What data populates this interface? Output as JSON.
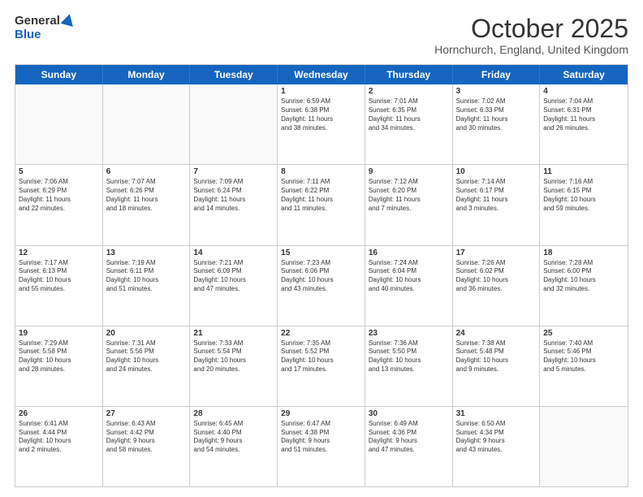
{
  "header": {
    "logo_line1": "General",
    "logo_line2": "Blue",
    "month": "October 2025",
    "location": "Hornchurch, England, United Kingdom"
  },
  "day_headers": [
    "Sunday",
    "Monday",
    "Tuesday",
    "Wednesday",
    "Thursday",
    "Friday",
    "Saturday"
  ],
  "weeks": [
    [
      {
        "date": "",
        "info": ""
      },
      {
        "date": "",
        "info": ""
      },
      {
        "date": "",
        "info": ""
      },
      {
        "date": "1",
        "info": "Sunrise: 6:59 AM\nSunset: 6:38 PM\nDaylight: 11 hours\nand 38 minutes."
      },
      {
        "date": "2",
        "info": "Sunrise: 7:01 AM\nSunset: 6:35 PM\nDaylight: 11 hours\nand 34 minutes."
      },
      {
        "date": "3",
        "info": "Sunrise: 7:02 AM\nSunset: 6:33 PM\nDaylight: 11 hours\nand 30 minutes."
      },
      {
        "date": "4",
        "info": "Sunrise: 7:04 AM\nSunset: 6:31 PM\nDaylight: 11 hours\nand 26 minutes."
      }
    ],
    [
      {
        "date": "5",
        "info": "Sunrise: 7:06 AM\nSunset: 6:29 PM\nDaylight: 11 hours\nand 22 minutes."
      },
      {
        "date": "6",
        "info": "Sunrise: 7:07 AM\nSunset: 6:26 PM\nDaylight: 11 hours\nand 18 minutes."
      },
      {
        "date": "7",
        "info": "Sunrise: 7:09 AM\nSunset: 6:24 PM\nDaylight: 11 hours\nand 14 minutes."
      },
      {
        "date": "8",
        "info": "Sunrise: 7:11 AM\nSunset: 6:22 PM\nDaylight: 11 hours\nand 11 minutes."
      },
      {
        "date": "9",
        "info": "Sunrise: 7:12 AM\nSunset: 6:20 PM\nDaylight: 11 hours\nand 7 minutes."
      },
      {
        "date": "10",
        "info": "Sunrise: 7:14 AM\nSunset: 6:17 PM\nDaylight: 11 hours\nand 3 minutes."
      },
      {
        "date": "11",
        "info": "Sunrise: 7:16 AM\nSunset: 6:15 PM\nDaylight: 10 hours\nand 59 minutes."
      }
    ],
    [
      {
        "date": "12",
        "info": "Sunrise: 7:17 AM\nSunset: 6:13 PM\nDaylight: 10 hours\nand 55 minutes."
      },
      {
        "date": "13",
        "info": "Sunrise: 7:19 AM\nSunset: 6:11 PM\nDaylight: 10 hours\nand 51 minutes."
      },
      {
        "date": "14",
        "info": "Sunrise: 7:21 AM\nSunset: 6:09 PM\nDaylight: 10 hours\nand 47 minutes."
      },
      {
        "date": "15",
        "info": "Sunrise: 7:23 AM\nSunset: 6:06 PM\nDaylight: 10 hours\nand 43 minutes."
      },
      {
        "date": "16",
        "info": "Sunrise: 7:24 AM\nSunset: 6:04 PM\nDaylight: 10 hours\nand 40 minutes."
      },
      {
        "date": "17",
        "info": "Sunrise: 7:26 AM\nSunset: 6:02 PM\nDaylight: 10 hours\nand 36 minutes."
      },
      {
        "date": "18",
        "info": "Sunrise: 7:28 AM\nSunset: 6:00 PM\nDaylight: 10 hours\nand 32 minutes."
      }
    ],
    [
      {
        "date": "19",
        "info": "Sunrise: 7:29 AM\nSunset: 5:58 PM\nDaylight: 10 hours\nand 28 minutes."
      },
      {
        "date": "20",
        "info": "Sunrise: 7:31 AM\nSunset: 5:56 PM\nDaylight: 10 hours\nand 24 minutes."
      },
      {
        "date": "21",
        "info": "Sunrise: 7:33 AM\nSunset: 5:54 PM\nDaylight: 10 hours\nand 20 minutes."
      },
      {
        "date": "22",
        "info": "Sunrise: 7:35 AM\nSunset: 5:52 PM\nDaylight: 10 hours\nand 17 minutes."
      },
      {
        "date": "23",
        "info": "Sunrise: 7:36 AM\nSunset: 5:50 PM\nDaylight: 10 hours\nand 13 minutes."
      },
      {
        "date": "24",
        "info": "Sunrise: 7:38 AM\nSunset: 5:48 PM\nDaylight: 10 hours\nand 9 minutes."
      },
      {
        "date": "25",
        "info": "Sunrise: 7:40 AM\nSunset: 5:46 PM\nDaylight: 10 hours\nand 5 minutes."
      }
    ],
    [
      {
        "date": "26",
        "info": "Sunrise: 6:41 AM\nSunset: 4:44 PM\nDaylight: 10 hours\nand 2 minutes."
      },
      {
        "date": "27",
        "info": "Sunrise: 6:43 AM\nSunset: 4:42 PM\nDaylight: 9 hours\nand 58 minutes."
      },
      {
        "date": "28",
        "info": "Sunrise: 6:45 AM\nSunset: 4:40 PM\nDaylight: 9 hours\nand 54 minutes."
      },
      {
        "date": "29",
        "info": "Sunrise: 6:47 AM\nSunset: 4:38 PM\nDaylight: 9 hours\nand 51 minutes."
      },
      {
        "date": "30",
        "info": "Sunrise: 6:49 AM\nSunset: 4:36 PM\nDaylight: 9 hours\nand 47 minutes."
      },
      {
        "date": "31",
        "info": "Sunrise: 6:50 AM\nSunset: 4:34 PM\nDaylight: 9 hours\nand 43 minutes."
      },
      {
        "date": "",
        "info": ""
      }
    ]
  ]
}
